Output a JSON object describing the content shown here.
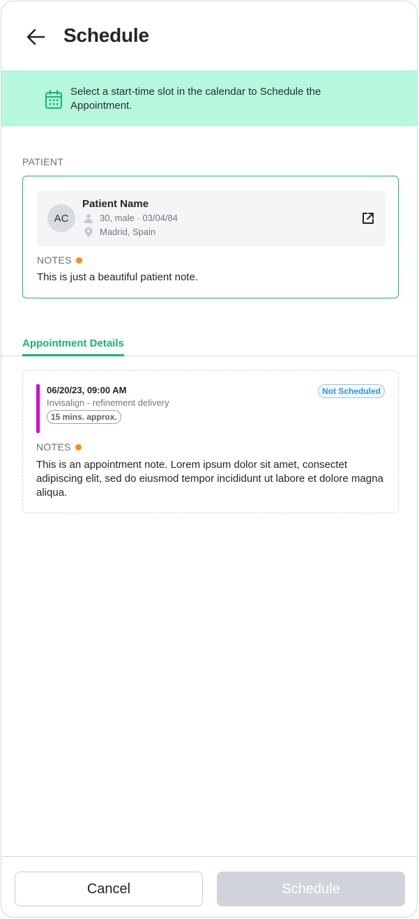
{
  "header": {
    "title": "Schedule"
  },
  "banner": {
    "message": "Select a start-time slot in the calendar to Schedule the Appointment."
  },
  "patient_section": {
    "label": "PATIENT",
    "initials": "AC",
    "name": "Patient Name",
    "demographics": "30, male · 03/04/84",
    "location": "Madrid, Spain",
    "notes_label": "NOTES",
    "notes_text": "This is just a beautiful patient note."
  },
  "tabs": {
    "active_label": "Appointment Details"
  },
  "appointment": {
    "datetime": "06/20/23, 09:00 AM",
    "type": "Invisalign - refinement delivery",
    "duration": "15 mins. approx.",
    "status": "Not Scheduled",
    "notes_label": "NOTES",
    "notes_text": "This is an appointment note. Lorem ipsum dolor sit amet, consectet adipiscing elit, sed do eiusmod tempor incididunt ut labore et dolore magna aliqua."
  },
  "footer": {
    "cancel_label": "Cancel",
    "schedule_label": "Schedule"
  },
  "colors": {
    "accent_green": "#12b76a",
    "banner_bg": "#b5f8dd",
    "notes_dot": "#f79009",
    "appointment_bar": "#d30bd9",
    "status_blue": "#2e90fa",
    "disabled_button": "#d0d4da"
  },
  "icons": {
    "back": "arrow-left-icon",
    "banner": "calendar-icon",
    "demographics": "person-icon",
    "location": "location-pin-icon",
    "open": "external-link-icon"
  }
}
